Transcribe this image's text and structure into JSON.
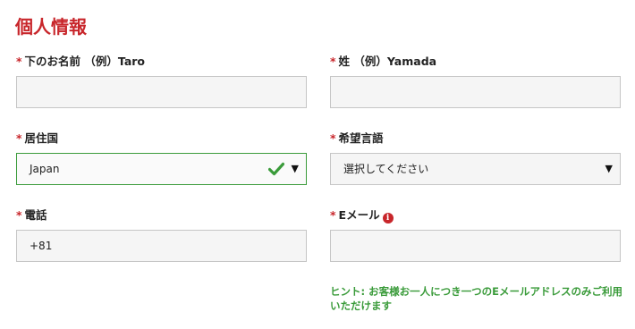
{
  "section": {
    "title": "個人情報"
  },
  "required_mark": "*",
  "fields": {
    "first_name": {
      "label": "下のお名前 （例）Taro",
      "value": ""
    },
    "last_name": {
      "label": "姓 （例）Yamada",
      "value": ""
    },
    "country": {
      "label": "居住国",
      "selected": "Japan",
      "valid": true,
      "icon": "checkmark-icon"
    },
    "language": {
      "label": "希望言語",
      "selected": "選択してください"
    },
    "phone": {
      "label": "電話",
      "value": "+81"
    },
    "email": {
      "label": "Eメール",
      "value": "",
      "info_icon": "info-icon"
    }
  },
  "dropdown_arrow": "▼",
  "info_glyph": "i",
  "hint": "ヒント: お客様お一人につき一つのEメールアドレスのみご利用いただけます",
  "colors": {
    "accent": "#c8262b",
    "valid": "#3a9b3a",
    "input_bg": "#f5f5f5",
    "border": "#c6c6c6"
  }
}
